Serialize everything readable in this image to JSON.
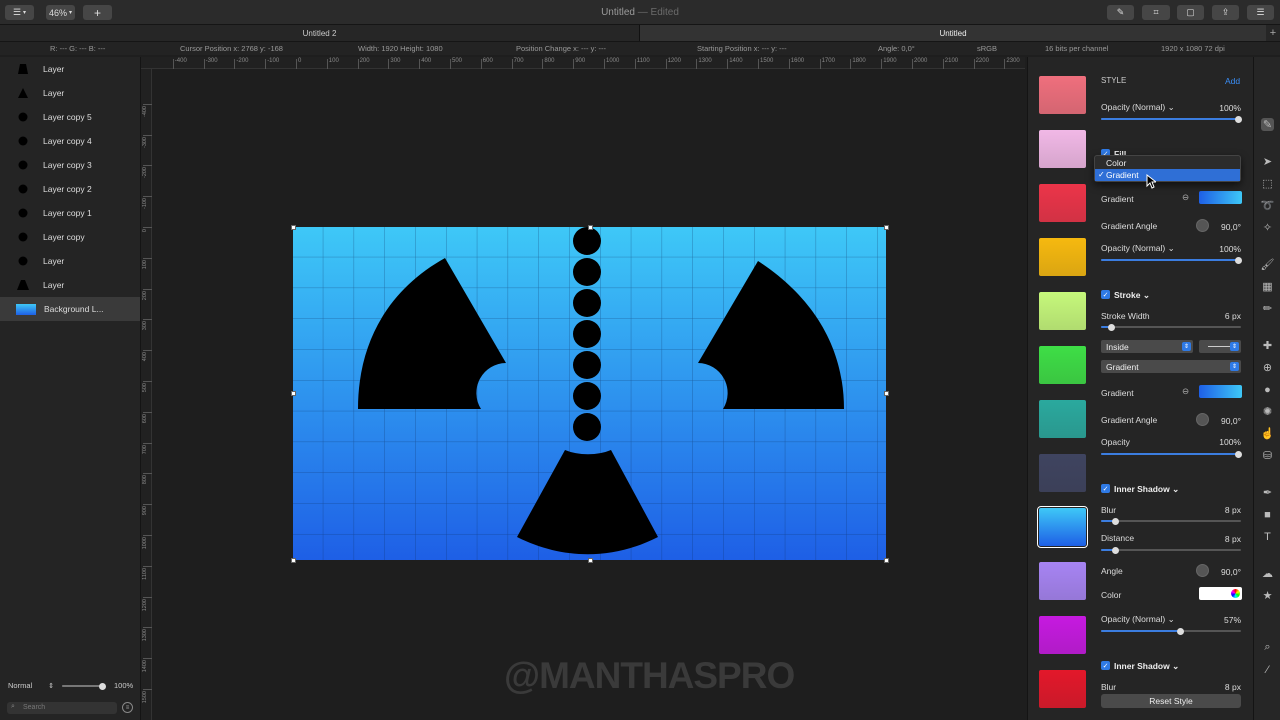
{
  "toolbar": {
    "sidebar_toggle": "☰",
    "zoom": "46%",
    "add": "+"
  },
  "window": {
    "title": "Untitled",
    "edited": " — Edited"
  },
  "tabs": [
    {
      "label": "Untitled 2"
    },
    {
      "label": "Untitled"
    }
  ],
  "info": {
    "rgb": "R: ---   G: ---   B: ---",
    "cursor": "Cursor Position x: 2768    y: -168",
    "size": "Width: 1920    Height: 1080",
    "poschange": "Position Change x: ---          y: ---",
    "startpos": "Starting Position x: ---          y: ---",
    "angle": "Angle: 0,0°",
    "profile": "sRGB",
    "depth": "16 bits per channel",
    "dims": "1920 x 1080 72 dpi"
  },
  "ruler": {
    "top": [
      "-400",
      "-300",
      "-200",
      "-100",
      "0",
      "100",
      "200",
      "300",
      "400",
      "500",
      "600",
      "700",
      "800",
      "900",
      "1000",
      "1100",
      "1200",
      "1300",
      "1400",
      "1500",
      "1600",
      "1700",
      "1800",
      "1900",
      "2000",
      "2100",
      "2200",
      "2300"
    ],
    "left": [
      "-400",
      "-300",
      "-200",
      "-100",
      "0",
      "100",
      "200",
      "300",
      "400",
      "500",
      "600",
      "700",
      "800",
      "900",
      "1000",
      "1100",
      "1200",
      "1300",
      "1400",
      "1500",
      "1600"
    ]
  },
  "layers": [
    {
      "label": "Layer"
    },
    {
      "label": "Layer"
    },
    {
      "label": "Layer copy 5"
    },
    {
      "label": "Layer copy 4"
    },
    {
      "label": "Layer copy 3"
    },
    {
      "label": "Layer copy 2"
    },
    {
      "label": "Layer copy 1"
    },
    {
      "label": "Layer copy"
    },
    {
      "label": "Layer"
    },
    {
      "label": "Layer"
    },
    {
      "label": "Background L..."
    }
  ],
  "layers_footer": {
    "blend": "Normal",
    "opacity": "100%",
    "search_placeholder": "Search"
  },
  "watermark": "@MANTHASPRO",
  "panel": {
    "style_label": "STYLE",
    "add_label": "Add",
    "opacity_normal": "Opacity (Normal) ⌄",
    "pct100": "100%",
    "fill_label": "Fill",
    "dropdown": {
      "options": [
        "Color",
        "Gradient"
      ],
      "selected": "Gradient"
    },
    "gradient_label": "Gradient",
    "gradient_angle_label": "Gradient Angle",
    "angle_90": "90,0°",
    "stroke_label": "Stroke ⌄",
    "stroke_width_label": "Stroke Width",
    "stroke_width_val": "6 px",
    "position_select": "Inside",
    "stroke_type_select": "Gradient",
    "opacity_label": "Opacity",
    "inner_shadow_label": "Inner Shadow ⌄",
    "blur_label": "Blur",
    "blur_val": "8 px",
    "distance_label": "Distance",
    "distance_val": "8 px",
    "angle_label": "Angle",
    "color_label": "Color",
    "opacity_57": "57%",
    "inner_shadow2_label": "Inner Shadow ⌄",
    "blur2_label": "Blur",
    "blur2_val": "8 px",
    "reset_label": "Reset Style"
  },
  "swatches": [
    "#ef6f7d",
    "#f1b8e6",
    "#ec3449",
    "#f6b90f",
    "#c6f87b",
    "#3ede46",
    "#2aa99e",
    "#3f4460",
    "#2f8cf3",
    "#a784f3",
    "#c61ae0",
    "#e3182a"
  ]
}
